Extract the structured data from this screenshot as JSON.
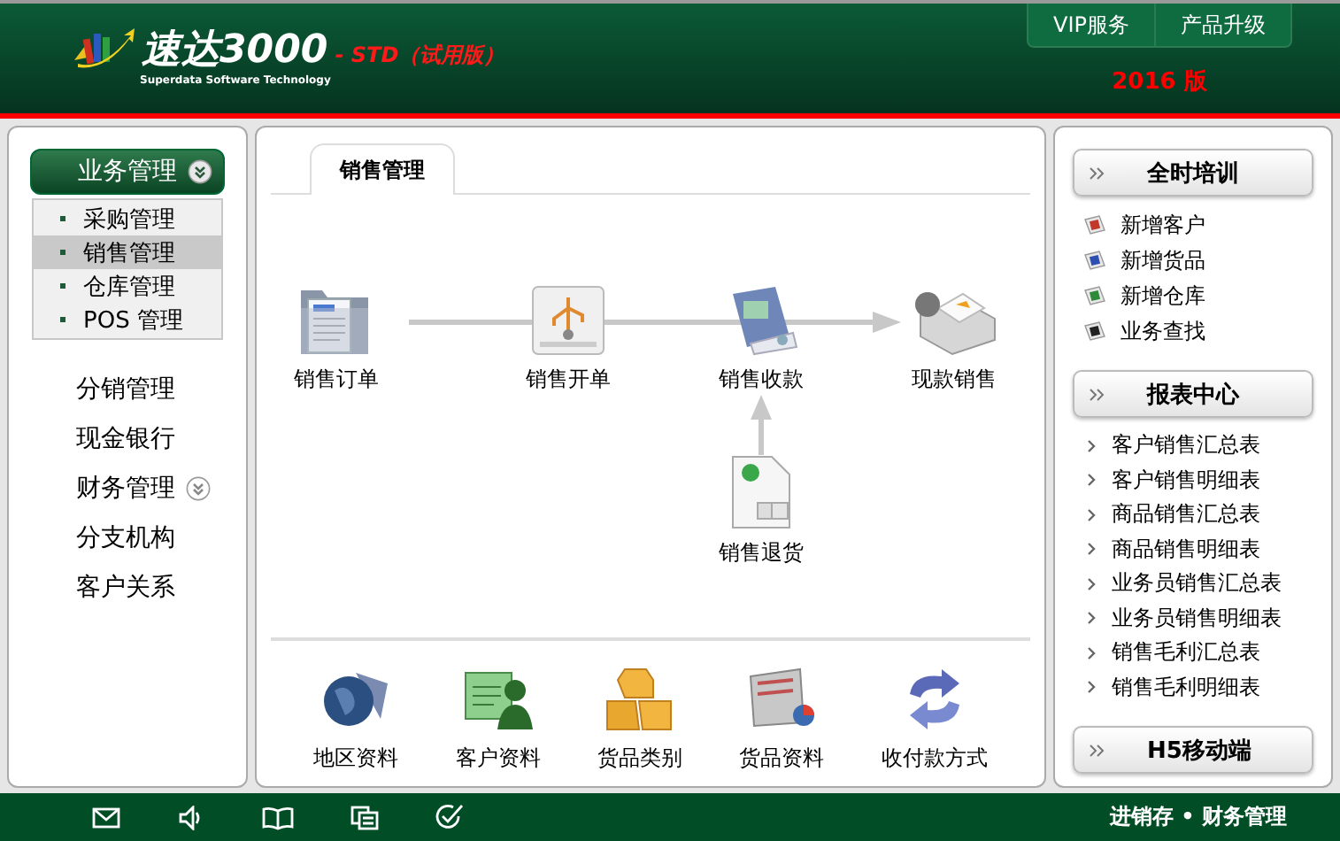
{
  "header": {
    "brand": "速达3000",
    "edition": "- STD（试用版）",
    "tagline": "Superdata Software Technology",
    "links": [
      "VIP服务",
      "产品升级"
    ],
    "version": "2016 版"
  },
  "sidebar": {
    "items": [
      {
        "label": "业务管理",
        "expanded": true,
        "children": [
          {
            "label": "采购管理",
            "selected": false
          },
          {
            "label": "销售管理",
            "selected": true
          },
          {
            "label": "仓库管理",
            "selected": false
          },
          {
            "label": "POS 管理",
            "selected": false
          }
        ]
      },
      {
        "label": "分销管理"
      },
      {
        "label": "现金银行"
      },
      {
        "label": "财务管理",
        "expanded": false
      },
      {
        "label": "分支机构"
      },
      {
        "label": "客户关系"
      }
    ]
  },
  "main": {
    "tabs": [
      {
        "label": "销售管理",
        "selected": true
      }
    ],
    "flow": [
      {
        "label": "销售订单"
      },
      {
        "label": "销售开单"
      },
      {
        "label": "销售收款"
      },
      {
        "label": "现款销售"
      },
      {
        "label": "销售退货"
      }
    ],
    "quick_links": [
      {
        "label": "地区资料"
      },
      {
        "label": "客户资料"
      },
      {
        "label": "货品类别"
      },
      {
        "label": "货品资料"
      },
      {
        "label": "收付款方式"
      }
    ]
  },
  "right": {
    "sections": [
      {
        "title": "全时培训",
        "kind": "icon-list",
        "items": [
          {
            "label": "新增客户",
            "color": "#c0392b"
          },
          {
            "label": "新增货品",
            "color": "#2e4fb0"
          },
          {
            "label": "新增仓库",
            "color": "#2e8b3a"
          },
          {
            "label": "业务查找",
            "color": "#222222"
          }
        ]
      },
      {
        "title": "报表中心",
        "kind": "chevron-list",
        "items": [
          {
            "label": "客户销售汇总表"
          },
          {
            "label": "客户销售明细表"
          },
          {
            "label": "商品销售汇总表"
          },
          {
            "label": "商品销售明细表"
          },
          {
            "label": "业务员销售汇总表"
          },
          {
            "label": "业务员销售明细表"
          },
          {
            "label": "销售毛利汇总表"
          },
          {
            "label": "销售毛利明细表"
          }
        ]
      },
      {
        "title": "H5移动端"
      }
    ]
  },
  "footer": {
    "text": "进销存 • 财务管理"
  }
}
